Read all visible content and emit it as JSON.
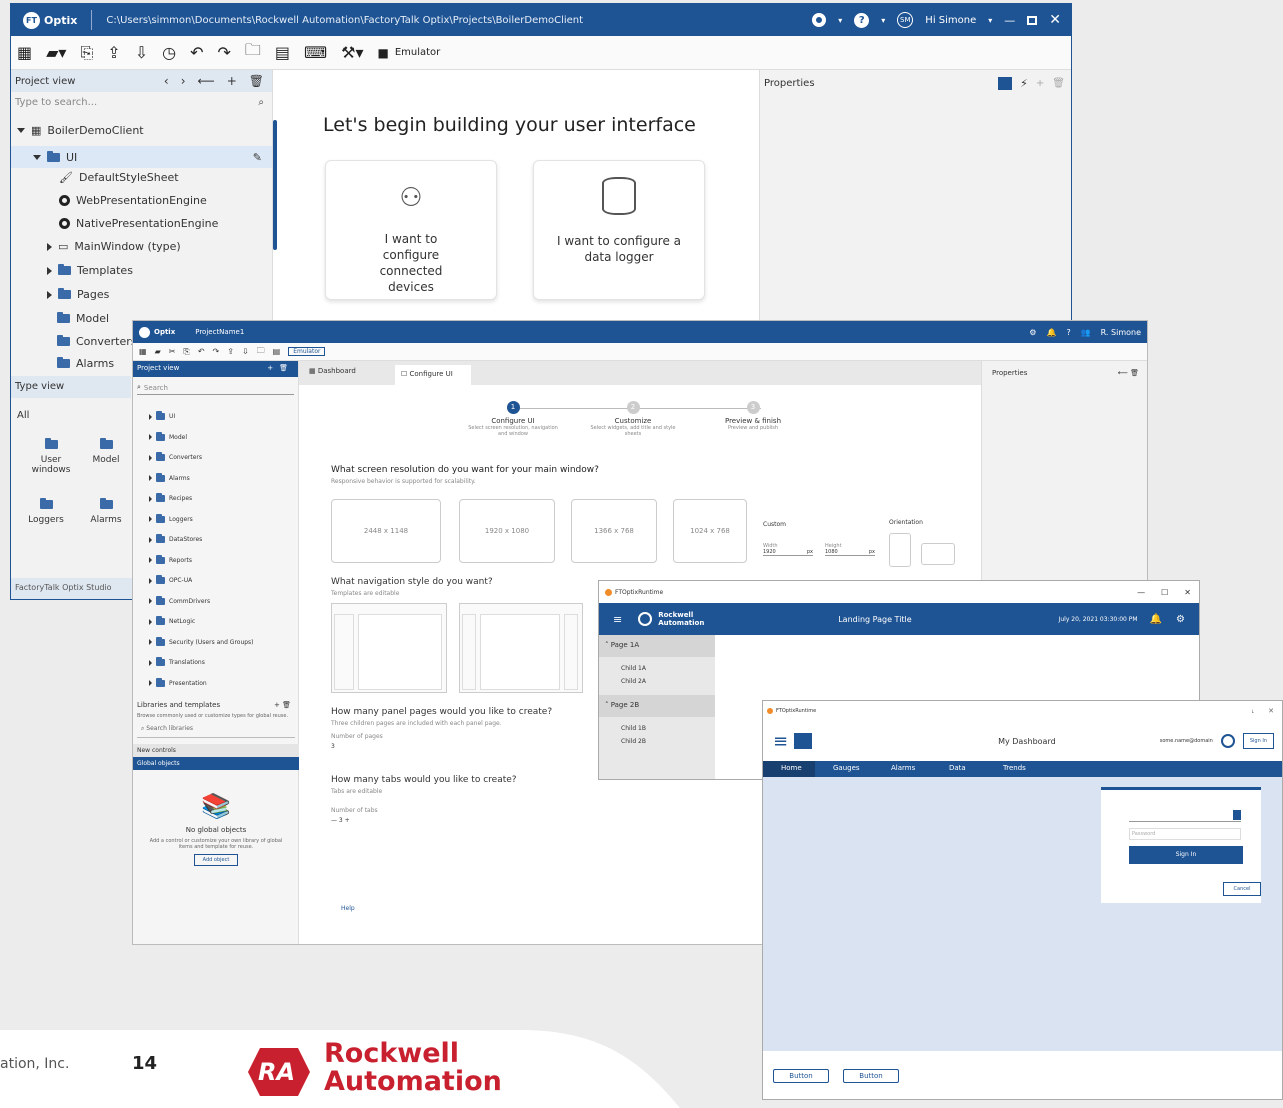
{
  "optix_main": {
    "logo": "Optix",
    "path": "C:\\Users\\simmon\\Documents\\Rockwell Automation\\FactoryTalk Optix\\Projects\\BoilerDemoClient",
    "user": "Hi Simone",
    "toolbar_run_target": "Emulator",
    "project_view": {
      "title": "Project view",
      "search_placeholder": "Type to search...",
      "root": "BoilerDemoClient",
      "items": [
        "UI",
        "DefaultStyleSheet",
        "WebPresentationEngine",
        "NativePresentationEngine",
        "MainWindow (type)",
        "Templates",
        "Pages",
        "Model",
        "Converters",
        "Alarms"
      ]
    },
    "type_view": {
      "title": "Type view",
      "filter": "All",
      "items": [
        "User windows",
        "Model",
        "Loggers",
        "Alarms"
      ]
    },
    "status": "FactoryTalk Optix Studio",
    "welcome_title": "Let's begin building your user interface",
    "cards": [
      "I want to configure connected devices",
      "I want to configure a data logger"
    ],
    "properties_title": "Properties"
  },
  "optix_wizard": {
    "logo": "Optix",
    "project": "ProjectName1",
    "user": "R. Simone",
    "toolbar_run_target": "Emulator",
    "project_view_title": "Project view",
    "search_placeholder": "Search",
    "tree": [
      "UI",
      "Model",
      "Converters",
      "Alarms",
      "Recipes",
      "Loggers",
      "DataStores",
      "Reports",
      "OPC-UA",
      "CommDrivers",
      "NetLogic",
      "Security (Users and Groups)",
      "Translations",
      "Presentation"
    ],
    "libraries_title": "Libraries and templates",
    "libraries_desc": "Browse commonly used or customize types for global reuse.",
    "libraries_search": "Search libraries",
    "libraries_rows": [
      "New controls",
      "Global objects"
    ],
    "no_global_title": "No global objects",
    "no_global_desc": "Add a control or customize your own library of global items and template for reuse.",
    "add_object": "Add object",
    "tab_dashboard": "Dashboard",
    "tab_configure": "Configure UI",
    "steps": [
      {
        "title": "Configure UI",
        "desc": "Select screen resolution, navigation and window"
      },
      {
        "title": "Customize",
        "desc": "Select widgets, add title and style sheets"
      },
      {
        "title": "Preview & finish",
        "desc": "Preview and publish"
      }
    ],
    "q_resolution": "What screen resolution do you want for your main window?",
    "q_resolution_sub": "Responsive behavior is supported for scalability.",
    "resolutions": [
      "2448 x 1148",
      "1920 x 1080",
      "1366 x 768",
      "1024 x 768"
    ],
    "custom_label": "Custom",
    "width_label": "Width",
    "width_value": "1920",
    "height_label": "Height",
    "height_value": "1080",
    "px": "px",
    "orientation_label": "Orientation",
    "q_navigation": "What navigation style do you want?",
    "q_navigation_sub": "Templates are editable",
    "q_panels": "How many panel pages would you like to create?",
    "q_panels_sub": "Three children pages are included with each panel page.",
    "panels_label": "Number of pages",
    "panels_value": "3",
    "q_tabs": "How many tabs would you like to create?",
    "q_tabs_sub": "Tabs are editable",
    "tabs_label": "Number of tabs",
    "tabs_value": "3",
    "help": "Help",
    "properties_title": "Properties"
  },
  "runtime_window": {
    "app_title": "FTOptixRuntime",
    "brand": "Rockwell Automation",
    "page_title": "Landing Page Title",
    "datetime": "July 20, 2021 03:30:00 PM",
    "nav": [
      {
        "label": "Page 1A",
        "children": [
          "Child 1A",
          "Child 2A"
        ]
      },
      {
        "label": "Page 2B",
        "children": [
          "Child 1B",
          "Child 2B"
        ]
      }
    ]
  },
  "dashboard_window": {
    "app_title": "FTOptixRuntime",
    "title": "My Dashboard",
    "user": "some.name@domain",
    "sign_in_top": "Sign In",
    "tabs": [
      "Home",
      "Gauges",
      "Alarms",
      "Data",
      "Trends"
    ],
    "password_placeholder": "Password",
    "sign_in": "Sign In",
    "cancel": "Cancel",
    "bottom_buttons": [
      "Button",
      "Button"
    ]
  },
  "footer": {
    "copyright": "ation, Inc.",
    "page_number": "14",
    "company_line1": "Rockwell",
    "company_line2": "Automation",
    "logo_mark": "RA"
  },
  "colors": {
    "title_bar": "#1f5494",
    "accent": "#1f5494",
    "brand_red": "#c8202f",
    "panel_bg": "#f2f2f2",
    "selection": "#dce8f5"
  }
}
